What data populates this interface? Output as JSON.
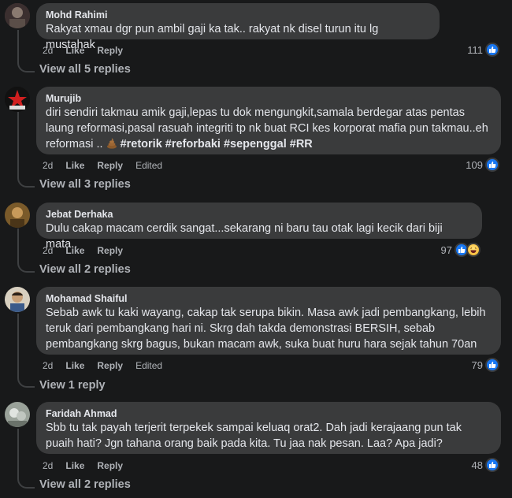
{
  "comments": [
    {
      "author": "Mohd Rahimi",
      "text": "Rakyat xmau dgr pun ambil gaji ka tak.. rakyat nk disel turun itu lg mustahak",
      "time": "2d",
      "like": "Like",
      "reply": "Reply",
      "reactions": "111",
      "view_replies": "View all 5 replies"
    },
    {
      "author": "Murujib",
      "text_line1": "diri sendiri takmau amik gaji,lepas tu dok mengungkit,samala berdegar atas pentas",
      "text_line2": "laung reformasi,pasal rasuah integriti tp nk buat RCI kes korporat mafia pun takmau..eh",
      "text_line3_prefix": "reformasi ..",
      "hashtags": "#retorik #reforbaki #sepenggal #RR",
      "time": "2d",
      "like": "Like",
      "reply": "Reply",
      "edited": "Edited",
      "reactions": "109",
      "view_replies": "View all 3 replies"
    },
    {
      "author": "Jebat Derhaka",
      "text": "Dulu cakap macam cerdik sangat...sekarang ni baru tau otak lagi kecik dari biji mata..",
      "time": "2d",
      "like": "Like",
      "reply": "Reply",
      "reactions": "97",
      "view_replies": "View all 2 replies"
    },
    {
      "author": "Mohamad Shaiful",
      "text_line1": "Sebab awk tu kaki wayang, cakap tak serupa bikin. Masa awk jadi pembangkang, lebih",
      "text_line2": "teruk dari pembangkang hari ni. Skrg dah takda demonstrasi BERSIH, sebab",
      "text_line3": "pembangkang skrg bagus, bukan macam awk, suka buat huru hara sejak tahun 70an",
      "time": "2d",
      "like": "Like",
      "reply": "Reply",
      "edited": "Edited",
      "reactions": "79",
      "view_replies": "View 1 reply"
    },
    {
      "author": "Faridah Ahmad",
      "text_line1": "Sbb tu tak payah terjerit terpekek sampai keluaq orat2. Dah jadi kerajaang pun tak",
      "text_line2": "puaih hati? Jgn tahana orang baik pada kita. Tu jaa nak pesan. Laa? Apa jadi?",
      "time": "2d",
      "like": "Like",
      "reply": "Reply",
      "reactions": "48",
      "view_replies": "View all 2 replies"
    }
  ],
  "icons": {
    "like": "thumbs-up-icon",
    "haha": "laughing-face-icon",
    "poop": "poop-emoji-icon"
  },
  "colors": {
    "background": "#18191a",
    "bubble": "#3a3b3c",
    "like_blue": "#1877f2",
    "muted": "#b0b3b8"
  }
}
